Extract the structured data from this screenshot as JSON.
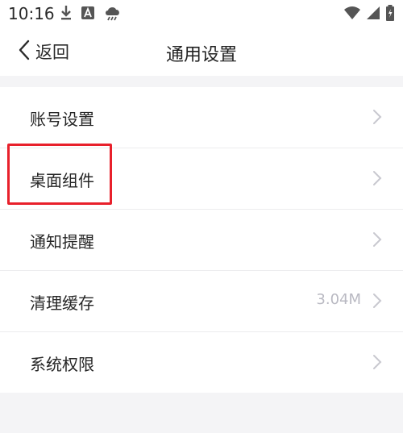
{
  "status": {
    "time": "10:16",
    "icons": [
      "download-icon",
      "a-badge-icon",
      "cloud-rain-icon",
      "wifi-icon",
      "signal-icon",
      "battery-icon"
    ]
  },
  "nav": {
    "back_label": "返回",
    "title": "通用设置"
  },
  "settings": [
    {
      "label": "账号设置",
      "value": ""
    },
    {
      "label": "桌面组件",
      "value": ""
    },
    {
      "label": "通知提醒",
      "value": ""
    },
    {
      "label": "清理缓存",
      "value": "3.04M"
    },
    {
      "label": "系统权限",
      "value": ""
    }
  ],
  "colors": {
    "highlight": "#e8202b",
    "chevron": "#c8c8cf",
    "background": "#f4f4f6"
  }
}
